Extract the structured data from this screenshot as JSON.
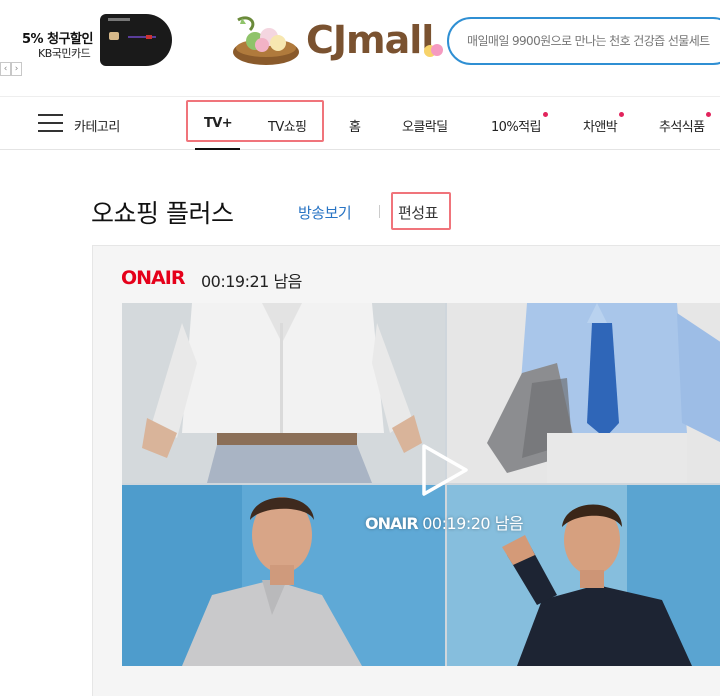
{
  "promo": {
    "title": "5% 청구할인",
    "subtitle": "KB국민카드",
    "prev_arrow": "‹",
    "next_arrow": "›"
  },
  "logo": {
    "text": "CJmall"
  },
  "search": {
    "placeholder": "매일매일 9900원으로 만나는 천호 건강즙 선물세트"
  },
  "nav": {
    "category_label": "카테고리",
    "items": [
      {
        "label": "TV+",
        "active": true
      },
      {
        "label": "TV쇼핑"
      },
      {
        "label": "홈"
      },
      {
        "label": "오클락딜"
      },
      {
        "label": "10%적립",
        "dot": true
      },
      {
        "label": "차앤박",
        "dot": true
      },
      {
        "label": "추석식품",
        "dot": true
      }
    ]
  },
  "page": {
    "title": "오쇼핑 플러스",
    "links": {
      "broadcast": "방송보기",
      "schedule": "편성표"
    }
  },
  "onair": {
    "label": "ONAIR",
    "remaining": "00:19:21 남음",
    "video_label": "ONAIR",
    "video_remaining": "00:19:20 남음"
  },
  "colors": {
    "accent_red": "#e5001a",
    "link_blue": "#2874c4",
    "search_border": "#2f8fd3",
    "highlight": "#f0747b",
    "dot": "#e2245c"
  },
  "icons": [
    "menu-icon",
    "play-icon",
    "new-dot-icon"
  ]
}
